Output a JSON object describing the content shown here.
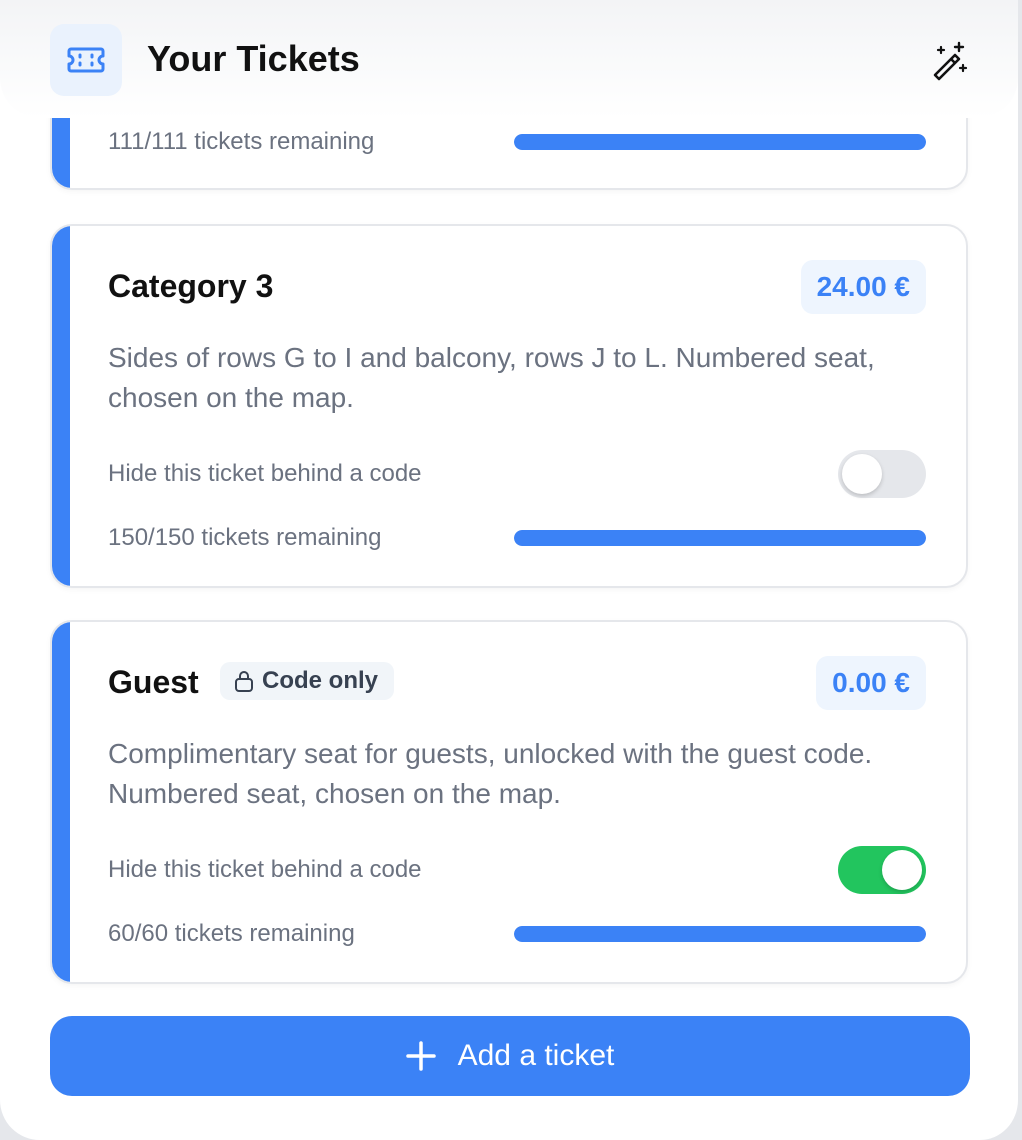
{
  "header": {
    "title": "Your Tickets",
    "logo_icon": "ticket-icon",
    "action_icon": "magic-wand-icon"
  },
  "colors": {
    "accent": "#3b82f6",
    "toggle_on": "#22c55e",
    "toggle_off": "#e5e7eb"
  },
  "tickets": [
    {
      "name": "",
      "remaining": "111/111 tickets remaining",
      "fill_fraction": 1.0
    },
    {
      "name": "Category 3",
      "price": "24.00 €",
      "description": "Sides of rows G to I and balcony, rows J to L. Numbered seat, chosen on the map.",
      "hide_label": "Hide this ticket behind a code",
      "hidden": false,
      "remaining": "150/150 tickets remaining",
      "fill_fraction": 1.0
    },
    {
      "name": "Guest",
      "badge": "Code only",
      "price": "0.00 €",
      "description": "Complimentary seat for guests, unlocked with the guest code. Numbered seat, chosen on the map.",
      "hide_label": "Hide this ticket behind a code",
      "hidden": true,
      "remaining": "60/60 tickets remaining",
      "fill_fraction": 1.0
    }
  ],
  "add_button": {
    "label": "Add a ticket",
    "icon": "plus-icon"
  }
}
